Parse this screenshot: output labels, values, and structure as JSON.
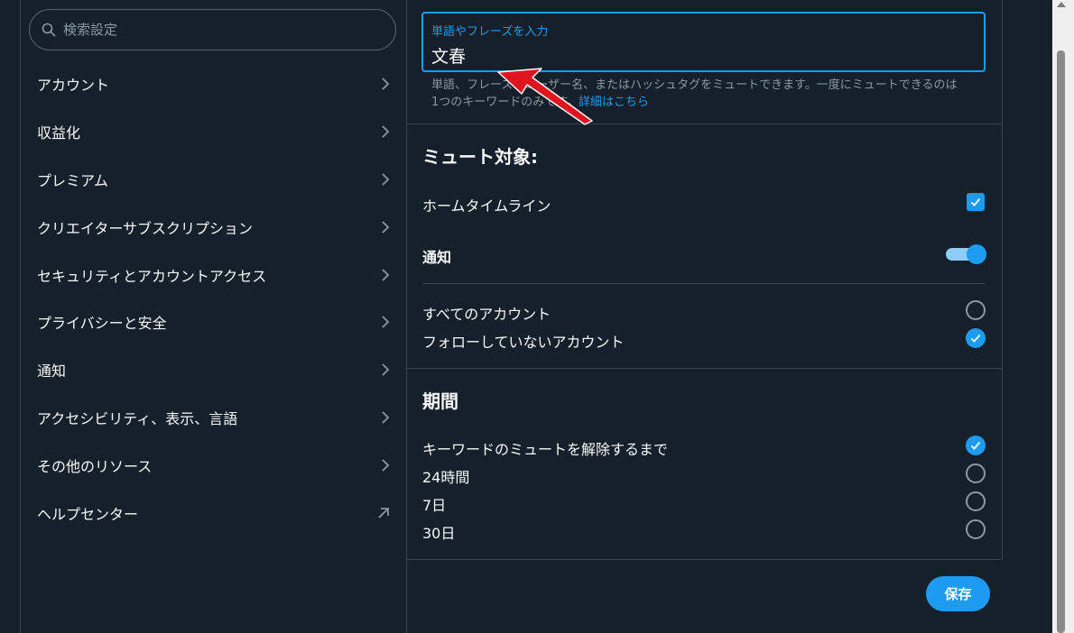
{
  "search": {
    "placeholder": "検索設定"
  },
  "nav": {
    "items": [
      {
        "label": "アカウント",
        "icon": "chevron-right-icon"
      },
      {
        "label": "収益化",
        "icon": "chevron-right-icon"
      },
      {
        "label": "プレミアム",
        "icon": "chevron-right-icon"
      },
      {
        "label": "クリエイターサブスクリプション",
        "icon": "chevron-right-icon"
      },
      {
        "label": "セキュリティとアカウントアクセス",
        "icon": "chevron-right-icon"
      },
      {
        "label": "プライバシーと安全",
        "icon": "chevron-right-icon"
      },
      {
        "label": "通知",
        "icon": "chevron-right-icon"
      },
      {
        "label": "アクセシビリティ、表示、言語",
        "icon": "chevron-right-icon"
      },
      {
        "label": "その他のリソース",
        "icon": "chevron-right-icon"
      },
      {
        "label": "ヘルプセンター",
        "icon": "external-link-arrow-icon"
      }
    ]
  },
  "keyword": {
    "label": "単語やフレーズを入力",
    "value": "文春",
    "help_text": "単語、フレーズ、ユーザー名、またはハッシュタグをミュートできます。一度にミュートできるのは1つのキーワードのみです。",
    "help_link": "詳細はこちら"
  },
  "mute_target": {
    "title": "ミュート対象:",
    "home_timeline": {
      "label": "ホームタイムライン",
      "checked": true
    },
    "notifications": {
      "label": "通知",
      "enabled": true
    },
    "accounts": [
      {
        "label": "すべてのアカウント",
        "selected": false
      },
      {
        "label": "フォローしていないアカウント",
        "selected": true
      }
    ]
  },
  "duration": {
    "title": "期間",
    "options": [
      {
        "label": "キーワードのミュートを解除するまで",
        "selected": true
      },
      {
        "label": "24時間",
        "selected": false
      },
      {
        "label": "7日",
        "selected": false
      },
      {
        "label": "30日",
        "selected": false
      }
    ]
  },
  "actions": {
    "save_label": "保存"
  },
  "colors": {
    "background": "#15202b",
    "accent": "#1d9bf0",
    "divider": "#38444d",
    "secondary_text": "#8b98a5",
    "annotation_arrow": "#e0141e"
  }
}
